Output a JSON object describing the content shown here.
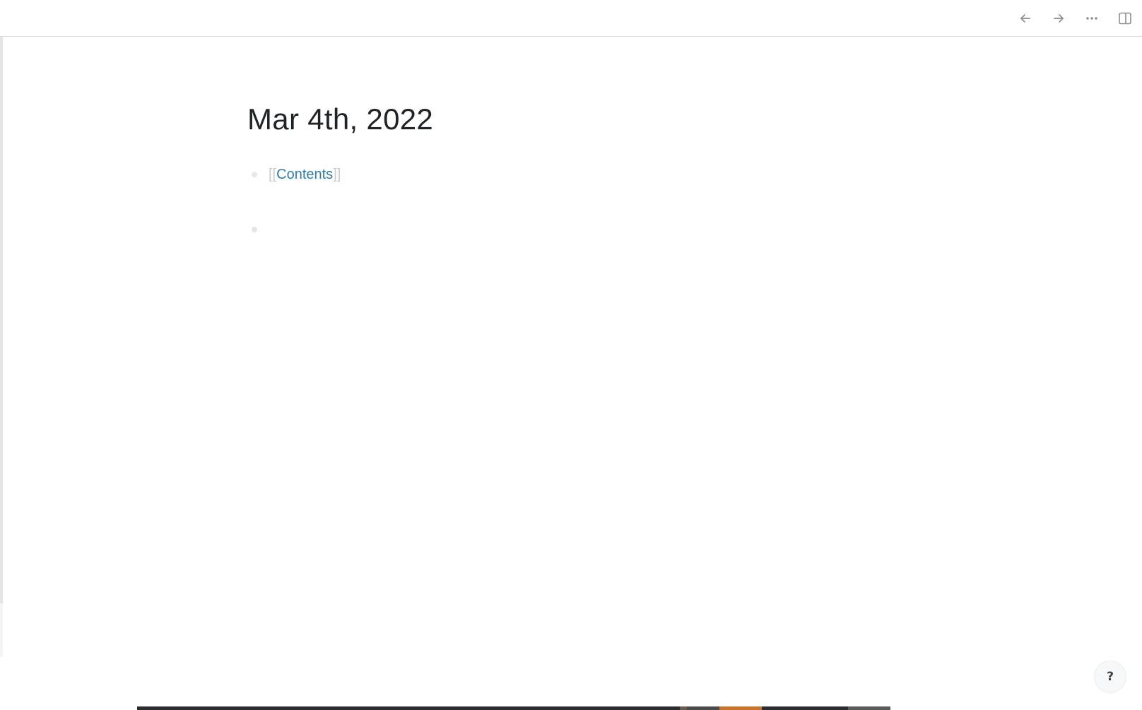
{
  "toolbar": {
    "back_icon": "arrow-left-icon",
    "forward_icon": "arrow-right-icon",
    "more_icon": "ellipsis-icon",
    "sidebar_icon": "right-sidebar-icon"
  },
  "page": {
    "title": "Mar 4th, 2022",
    "blocks": [
      {
        "open_bracket": "[[",
        "ref": "Contents",
        "close_bracket": "]]"
      },
      {
        "text": ""
      }
    ]
  },
  "help": {
    "label": "?"
  },
  "colors": {
    "link": "#2f7ea8",
    "bracket": "#c7cbd0",
    "bullet": "#e4e6e8",
    "title": "#1f2326",
    "icon": "#8a8d91"
  }
}
